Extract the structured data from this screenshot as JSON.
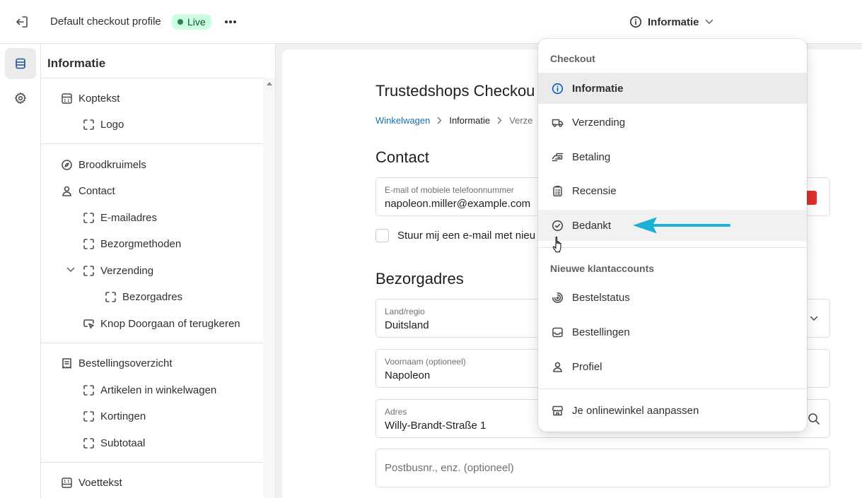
{
  "topbar": {
    "profile_name": "Default checkout profile",
    "status_badge": "Live",
    "page_selector": "Informatie"
  },
  "sidebar": {
    "title": "Informatie",
    "items": [
      {
        "label": "Koptekst",
        "icon": "header-layout-icon"
      },
      {
        "label": "Logo",
        "icon": "block-frame-icon"
      },
      {
        "label": "Broodkruimels",
        "icon": "compass-icon"
      },
      {
        "label": "Contact",
        "icon": "person-icon"
      },
      {
        "label": "E-mailadres",
        "icon": "block-frame-icon"
      },
      {
        "label": "Bezorgmethoden",
        "icon": "block-frame-icon"
      },
      {
        "label": "Verzending",
        "icon": "block-frame-icon"
      },
      {
        "label": "Bezorgadres",
        "icon": "block-frame-icon"
      },
      {
        "label": "Knop Doorgaan of terugkeren",
        "icon": "button-cursor-icon"
      },
      {
        "label": "Bestellingsoverzicht",
        "icon": "receipt-icon"
      },
      {
        "label": "Artikelen in winkelwagen",
        "icon": "block-frame-icon"
      },
      {
        "label": "Kortingen",
        "icon": "block-frame-icon"
      },
      {
        "label": "Subtotaal",
        "icon": "block-frame-icon"
      },
      {
        "label": "Voettekst",
        "icon": "footer-layout-icon"
      }
    ]
  },
  "preview": {
    "store_title": "Trustedshops Checkou",
    "breadcrumb": [
      "Winkelwagen",
      "Informatie",
      "Verze"
    ],
    "contact_heading": "Contact",
    "email_label": "E-mail of mobiele telefoonnummer",
    "email_value": "napoleon.miller@example.com",
    "newsletter_label": "Stuur mij een e-mail met nieu",
    "address_heading": "Bezorgadres",
    "country_label": "Land/regio",
    "country_value": "Duitsland",
    "firstname_label": "Voornaam (optioneel)",
    "firstname_value": "Napoleon",
    "address_label": "Adres",
    "address_value": "Willy-Brandt-Straße 1",
    "apartment_placeholder": "Postbusnr., enz. (optioneel)"
  },
  "dropdown": {
    "checkout_heading": "Checkout",
    "checkout_items": [
      {
        "label": "Informatie",
        "icon": "info-icon"
      },
      {
        "label": "Verzending",
        "icon": "truck-icon"
      },
      {
        "label": "Betaling",
        "icon": "cash-icon"
      },
      {
        "label": "Recensie",
        "icon": "clipboard-icon"
      },
      {
        "label": "Bedankt",
        "icon": "check-circle-icon"
      }
    ],
    "accounts_heading": "Nieuwe klantaccounts",
    "accounts_items": [
      {
        "label": "Bestelstatus",
        "icon": "progress-icon"
      },
      {
        "label": "Bestellingen",
        "icon": "inbox-icon"
      },
      {
        "label": "Profiel",
        "icon": "person-icon"
      }
    ],
    "customize_label": "Je onlinewinkel aanpassen"
  },
  "colors": {
    "accent_blue": "#005bd3",
    "annotation_arrow": "#1ab0d8",
    "live_badge_bg": "#cdfee1",
    "live_badge_text": "#0c5132"
  }
}
